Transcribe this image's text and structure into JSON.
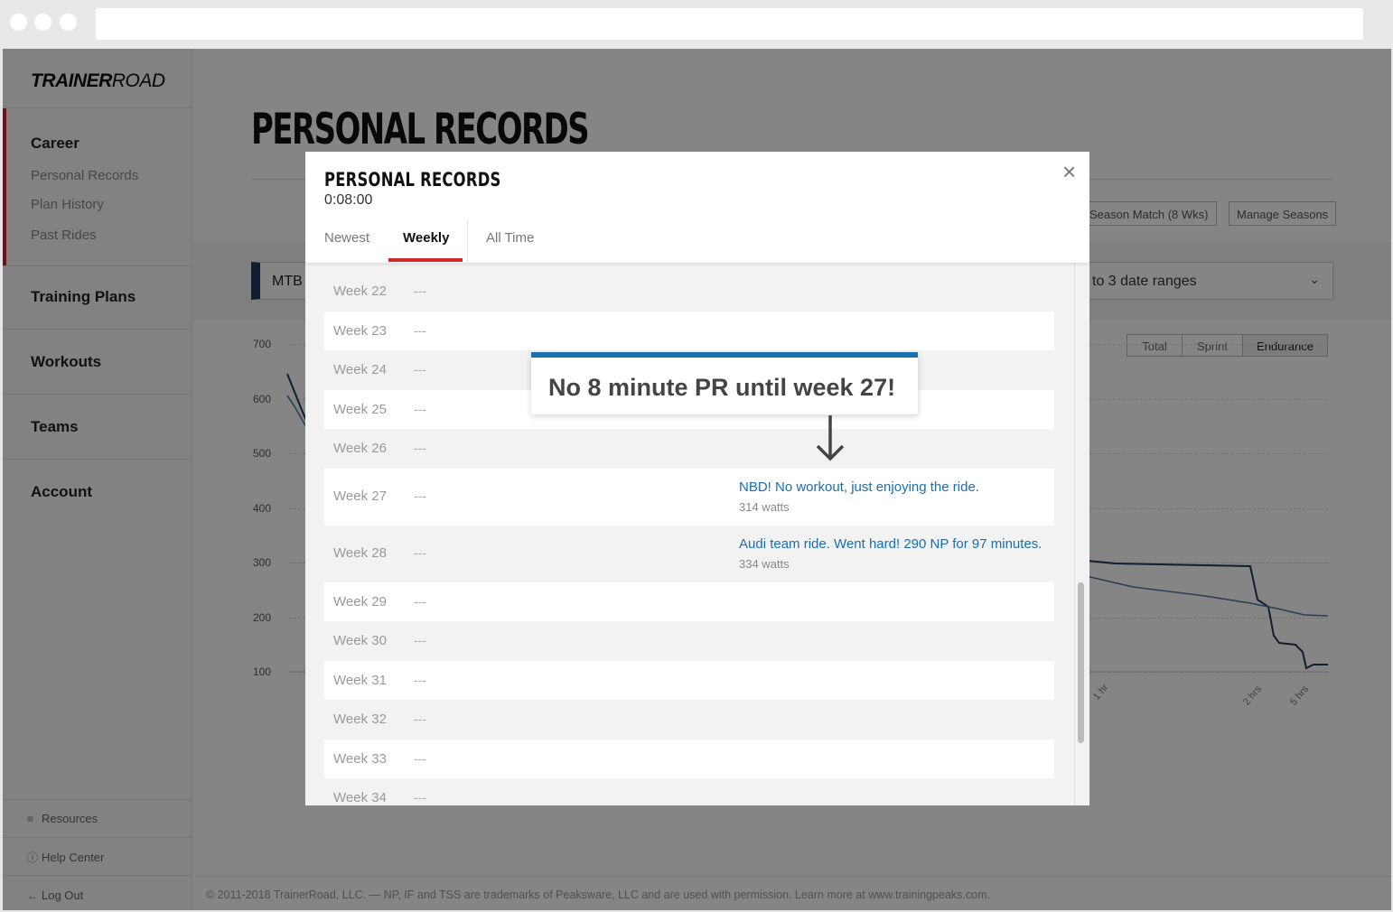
{
  "app": {
    "logo_bold": "TRAINER",
    "logo_light": "ROAD"
  },
  "sidebar": {
    "career": "Career",
    "career_items": [
      "Personal Records",
      "Plan History",
      "Past Rides"
    ],
    "training_plans": "Training Plans",
    "workouts": "Workouts",
    "teams": "Teams",
    "account": "Account",
    "resources": "Resources",
    "help_center": "Help Center",
    "log_out": "Log Out"
  },
  "page": {
    "title": "PERSONAL RECORDS",
    "season_match": "Season Match (8 Wks)",
    "manage_seasons": "Manage Seasons",
    "bike_filter": "MTB",
    "date_range": "to 3 date ranges",
    "power_types": [
      "Total",
      "Sprint",
      "Endurance"
    ],
    "active_power_type": "Endurance",
    "footer": "© 2011-2018 TrainerRoad, LLC. — NP, IF and TSS are trademarks of Peaksware, LLC and are used with permission. Learn more at www.trainingpeaks.com."
  },
  "chart": {
    "y_ticks": [
      "700",
      "600",
      "500",
      "400",
      "300",
      "200",
      "100"
    ],
    "x_ticks": [
      "1 hr",
      "2 hrs",
      "5 hrs"
    ]
  },
  "modal": {
    "title": "PERSONAL RECORDS",
    "duration": "0:08:00",
    "tabs": [
      "Newest",
      "Weekly",
      "All Time"
    ],
    "active_tab": "Weekly",
    "close": "×",
    "weeks": [
      {
        "week": "Week 22",
        "value": "---"
      },
      {
        "week": "Week 23",
        "value": "---"
      },
      {
        "week": "Week 24",
        "value": "---"
      },
      {
        "week": "Week 25",
        "value": "---"
      },
      {
        "week": "Week 26",
        "value": "---"
      },
      {
        "week": "Week 27",
        "value": "---",
        "ride": "NBD! No workout, just enjoying the ride.",
        "watts": "314 watts"
      },
      {
        "week": "Week 28",
        "value": "---",
        "ride": "Audi team ride. Went hard! 290 NP for 97 minutes.",
        "watts": "334 watts"
      },
      {
        "week": "Week 29",
        "value": "---"
      },
      {
        "week": "Week 30",
        "value": "---"
      },
      {
        "week": "Week 31",
        "value": "---"
      },
      {
        "week": "Week 32",
        "value": "---"
      },
      {
        "week": "Week 33",
        "value": "---"
      },
      {
        "week": "Week 34",
        "value": "---"
      }
    ]
  },
  "callout": {
    "text": "No 8 minute PR until week 27!"
  },
  "colors": {
    "accent_red": "#d0262c",
    "link_blue": "#1a6fb0",
    "navy": "#1d3a5c"
  }
}
